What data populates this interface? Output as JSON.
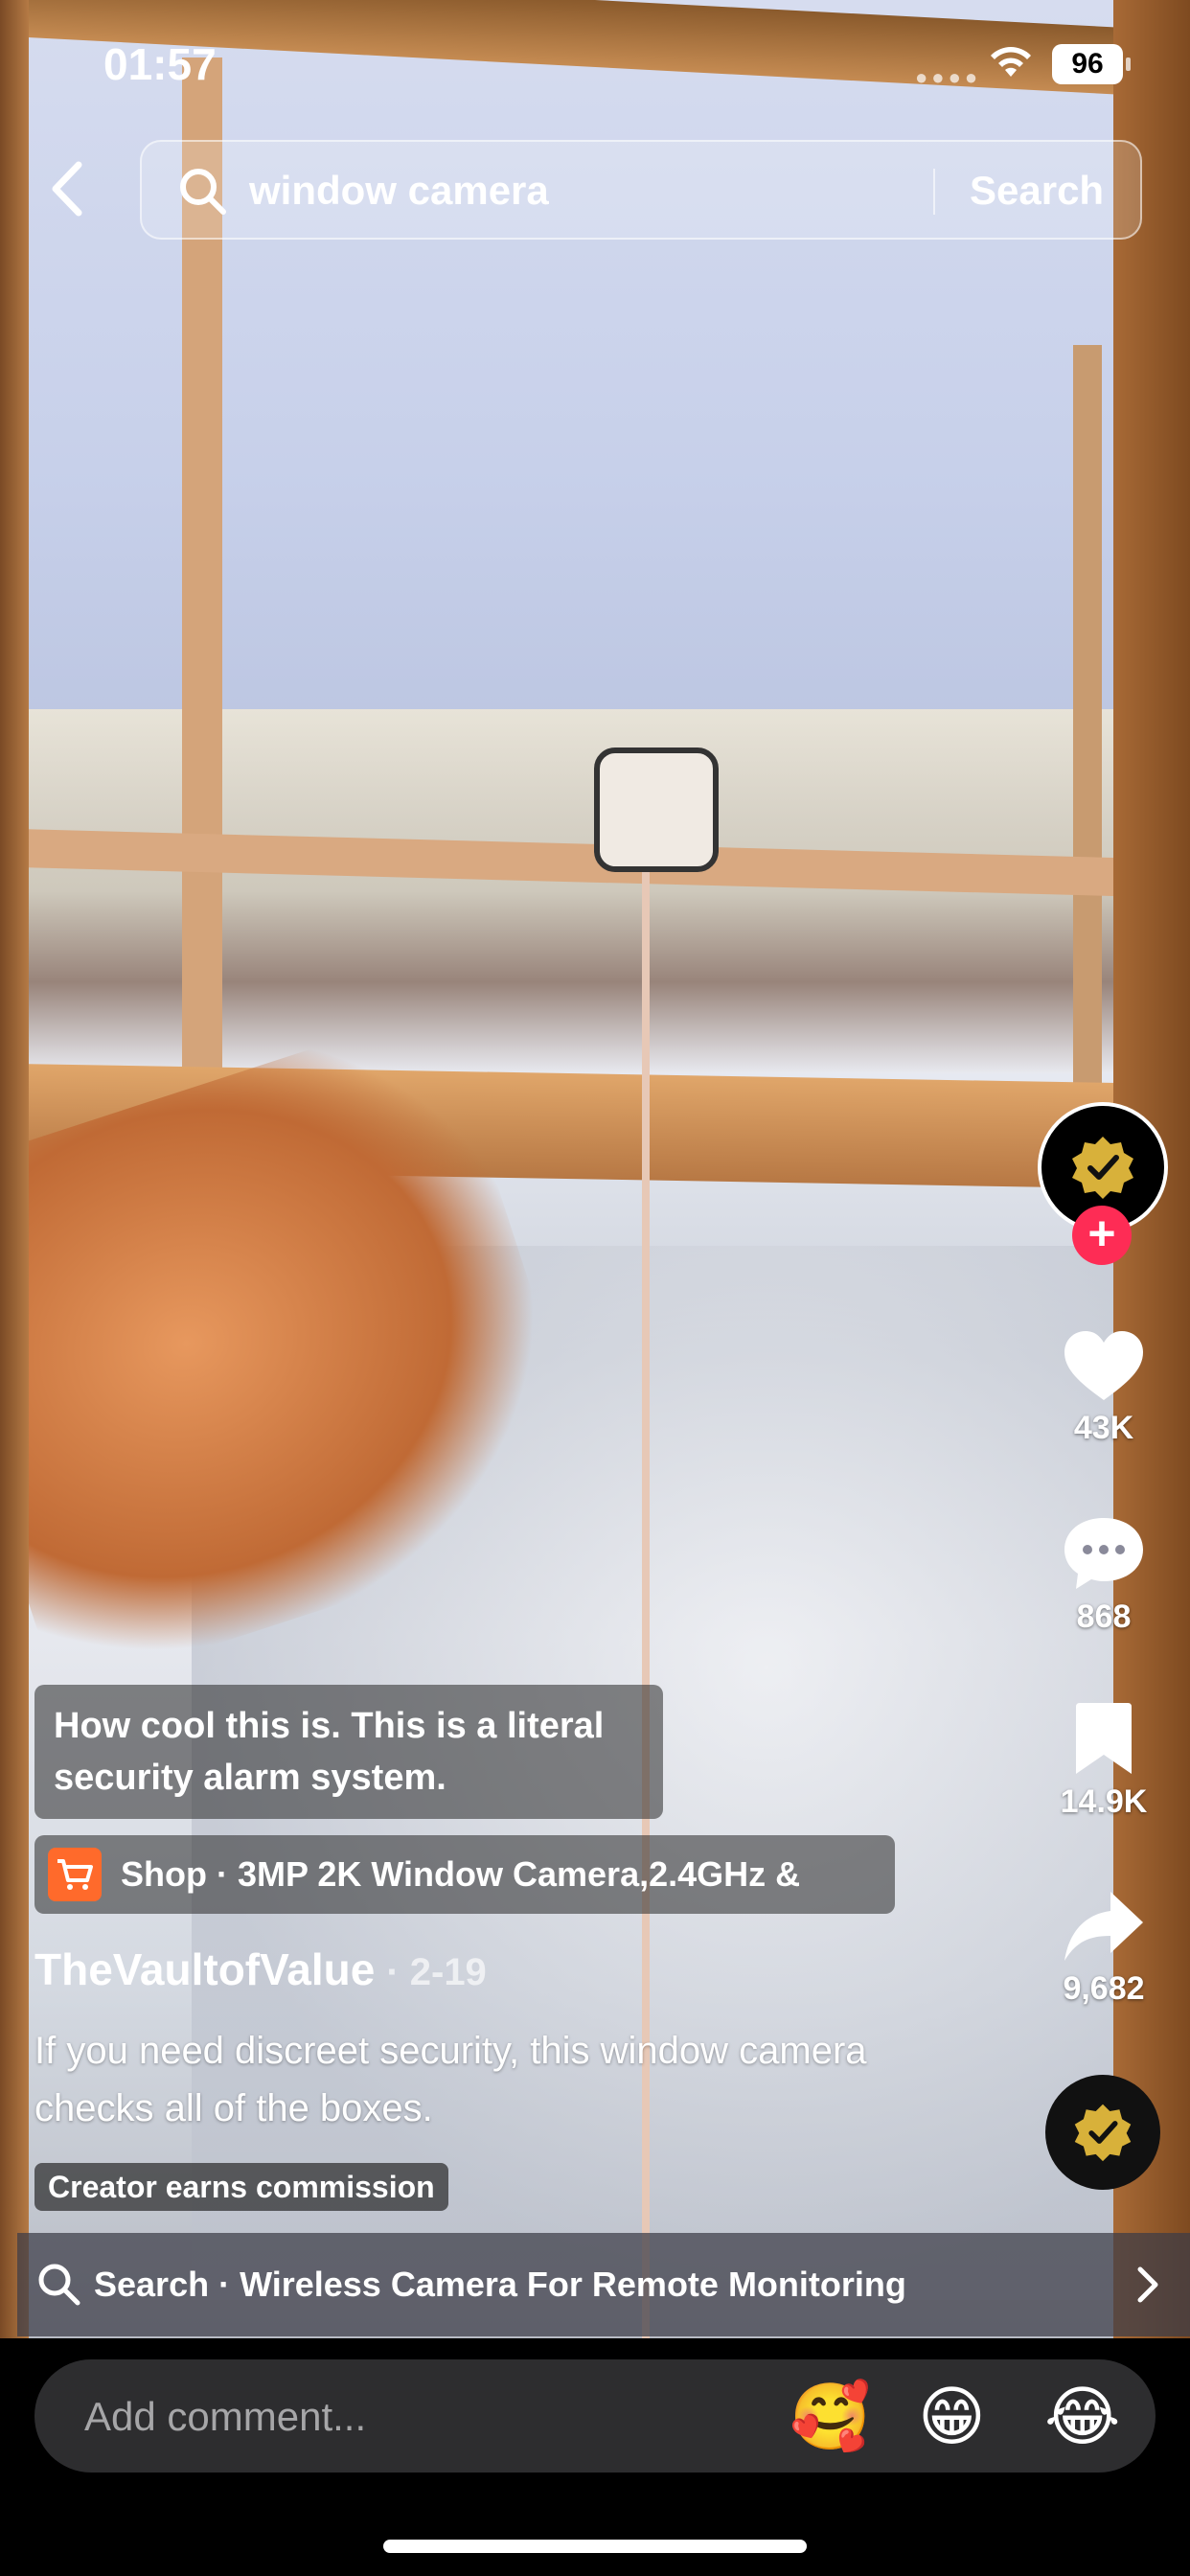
{
  "status_bar": {
    "time": "01:57",
    "battery": "96"
  },
  "header": {
    "search_query": "window camera",
    "search_button": "Search"
  },
  "overlay_caption": "How cool this is. This is a literal security alarm system.",
  "shop": {
    "text": "Shop · 3MP 2K Window Camera,2.4GHz &"
  },
  "post": {
    "author": "TheVaultofValue",
    "date": "· 2-19",
    "description": "If you need discreet security, this window camera checks all of the boxes.",
    "badge": "Creator earns commission"
  },
  "actions": {
    "likes": "43K",
    "comments": "868",
    "saves": "14.9K",
    "shares": "9,682"
  },
  "related_search": {
    "text": "Search · Wireless Camera For Remote Monitoring"
  },
  "comment_bar": {
    "placeholder": "Add comment...",
    "emojis": [
      "🥰",
      "😁",
      "😂"
    ]
  },
  "icons": {
    "back": "chevron-left-icon",
    "search": "search-icon",
    "like": "heart-icon",
    "comment": "comment-bubble-icon",
    "save": "bookmark-icon",
    "share": "share-arrow-icon",
    "shop": "cart-icon",
    "related_chevron": "chevron-right-icon"
  },
  "colors": {
    "follow_badge": "#fe2c55",
    "shop_icon": "#ff6a2b",
    "avatar_check": "#d8b13a"
  }
}
